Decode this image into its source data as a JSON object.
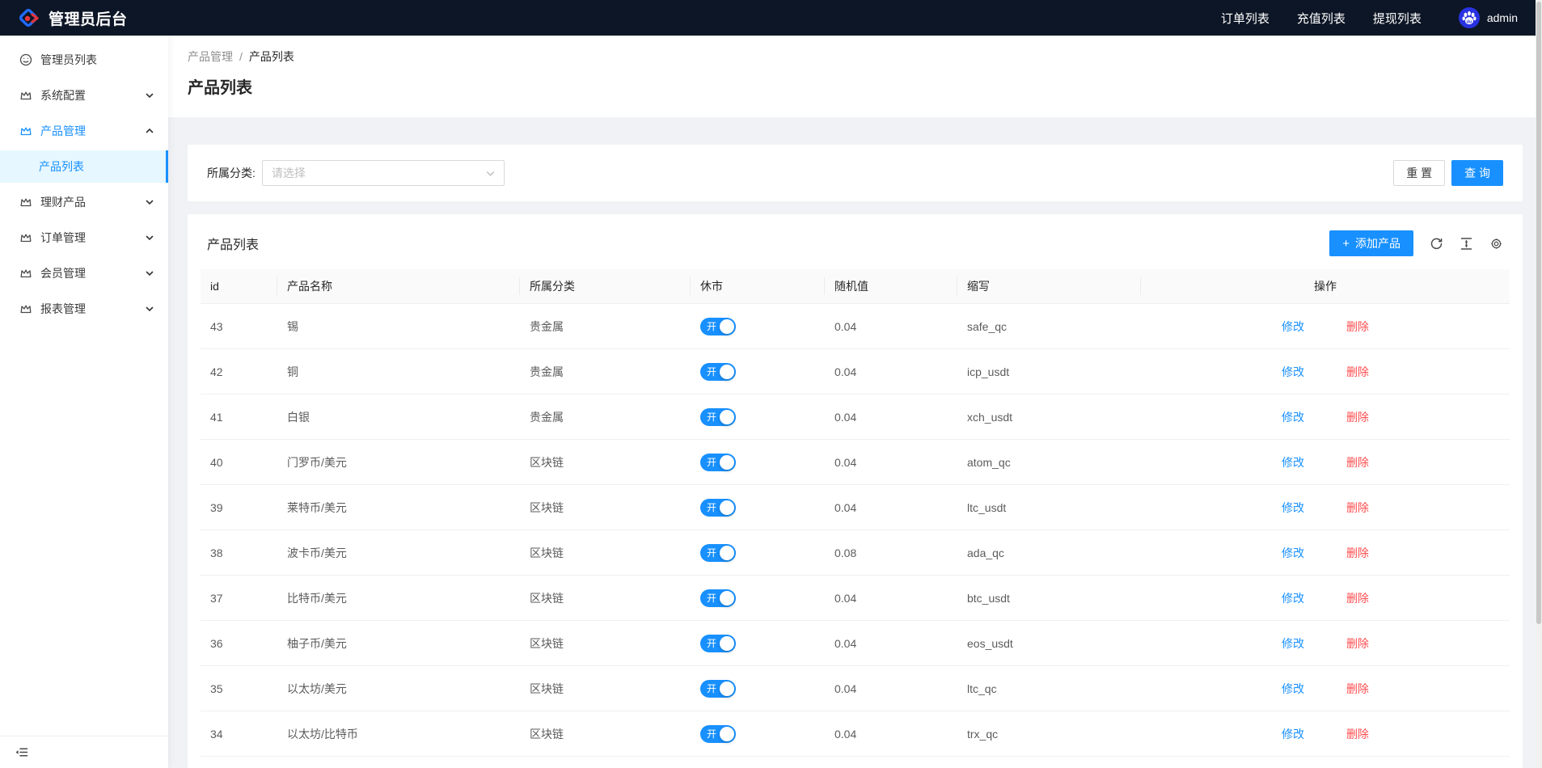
{
  "colors": {
    "primary": "#1890ff",
    "danger": "#ff4d4f",
    "topbar_bg": "#0d1626",
    "selected_bg": "#e6f7ff",
    "avatar_bg": "#2932e1"
  },
  "icons": {
    "logo": "diamond-logo-icon",
    "avatar": "paw-avatar-icon",
    "first_menu": "smile-icon",
    "menu": "crown-icon",
    "expand": "chevron-down-icon",
    "collapse": "chevron-up-icon",
    "toolbar": [
      "reload-icon",
      "column-height-icon",
      "setting-icon"
    ],
    "footer": "menu-fold-icon"
  },
  "header": {
    "title": "管理员后台",
    "nav": [
      {
        "label": "订单列表"
      },
      {
        "label": "充值列表"
      },
      {
        "label": "提现列表"
      }
    ],
    "username": "admin"
  },
  "sidebar": {
    "items": [
      {
        "label": "管理员列表",
        "icon": "smile-icon"
      },
      {
        "label": "系统配置",
        "icon": "crown-icon",
        "chevron": "down"
      },
      {
        "label": "产品管理",
        "icon": "crown-icon",
        "chevron": "up",
        "active": true
      },
      {
        "label": "产品列表",
        "submenu": true,
        "selected": true
      },
      {
        "label": "理财产品",
        "icon": "crown-icon",
        "chevron": "down"
      },
      {
        "label": "订单管理",
        "icon": "crown-icon",
        "chevron": "down"
      },
      {
        "label": "会员管理",
        "icon": "crown-icon",
        "chevron": "down"
      },
      {
        "label": "报表管理",
        "icon": "crown-icon",
        "chevron": "down"
      }
    ]
  },
  "breadcrumb": {
    "parent": "产品管理",
    "separator": "/",
    "current": "产品列表"
  },
  "page": {
    "title": "产品列表"
  },
  "filter": {
    "label": "所属分类:",
    "select_placeholder": "请选择",
    "reset_label": "重 置",
    "query_label": "查 询"
  },
  "table": {
    "card_title": "产品列表",
    "add_button_label": "添加产品",
    "plus_sign": "+",
    "columns": [
      "id",
      "产品名称",
      "所属分类",
      "休市",
      "随机值",
      "缩写",
      "操作"
    ],
    "switch_on_label": "开",
    "actions": {
      "edit": "修改",
      "delete": "删除"
    },
    "rows": [
      {
        "id": "43",
        "name": "锡",
        "category": "贵金属",
        "market_open": true,
        "random": "0.04",
        "abbr": "safe_qc"
      },
      {
        "id": "42",
        "name": "铜",
        "category": "贵金属",
        "market_open": true,
        "random": "0.04",
        "abbr": "icp_usdt"
      },
      {
        "id": "41",
        "name": "白银",
        "category": "贵金属",
        "market_open": true,
        "random": "0.04",
        "abbr": "xch_usdt"
      },
      {
        "id": "40",
        "name": "门罗币/美元",
        "category": "区块链",
        "market_open": true,
        "random": "0.04",
        "abbr": "atom_qc"
      },
      {
        "id": "39",
        "name": "莱特币/美元",
        "category": "区块链",
        "market_open": true,
        "random": "0.04",
        "abbr": "ltc_usdt"
      },
      {
        "id": "38",
        "name": "波卡币/美元",
        "category": "区块链",
        "market_open": true,
        "random": "0.08",
        "abbr": "ada_qc"
      },
      {
        "id": "37",
        "name": "比特币/美元",
        "category": "区块链",
        "market_open": true,
        "random": "0.04",
        "abbr": "btc_usdt"
      },
      {
        "id": "36",
        "name": "柚子币/美元",
        "category": "区块链",
        "market_open": true,
        "random": "0.04",
        "abbr": "eos_usdt"
      },
      {
        "id": "35",
        "name": "以太坊/美元",
        "category": "区块链",
        "market_open": true,
        "random": "0.04",
        "abbr": "ltc_qc"
      },
      {
        "id": "34",
        "name": "以太坊/比特币",
        "category": "区块链",
        "market_open": true,
        "random": "0.04",
        "abbr": "trx_qc"
      }
    ]
  }
}
